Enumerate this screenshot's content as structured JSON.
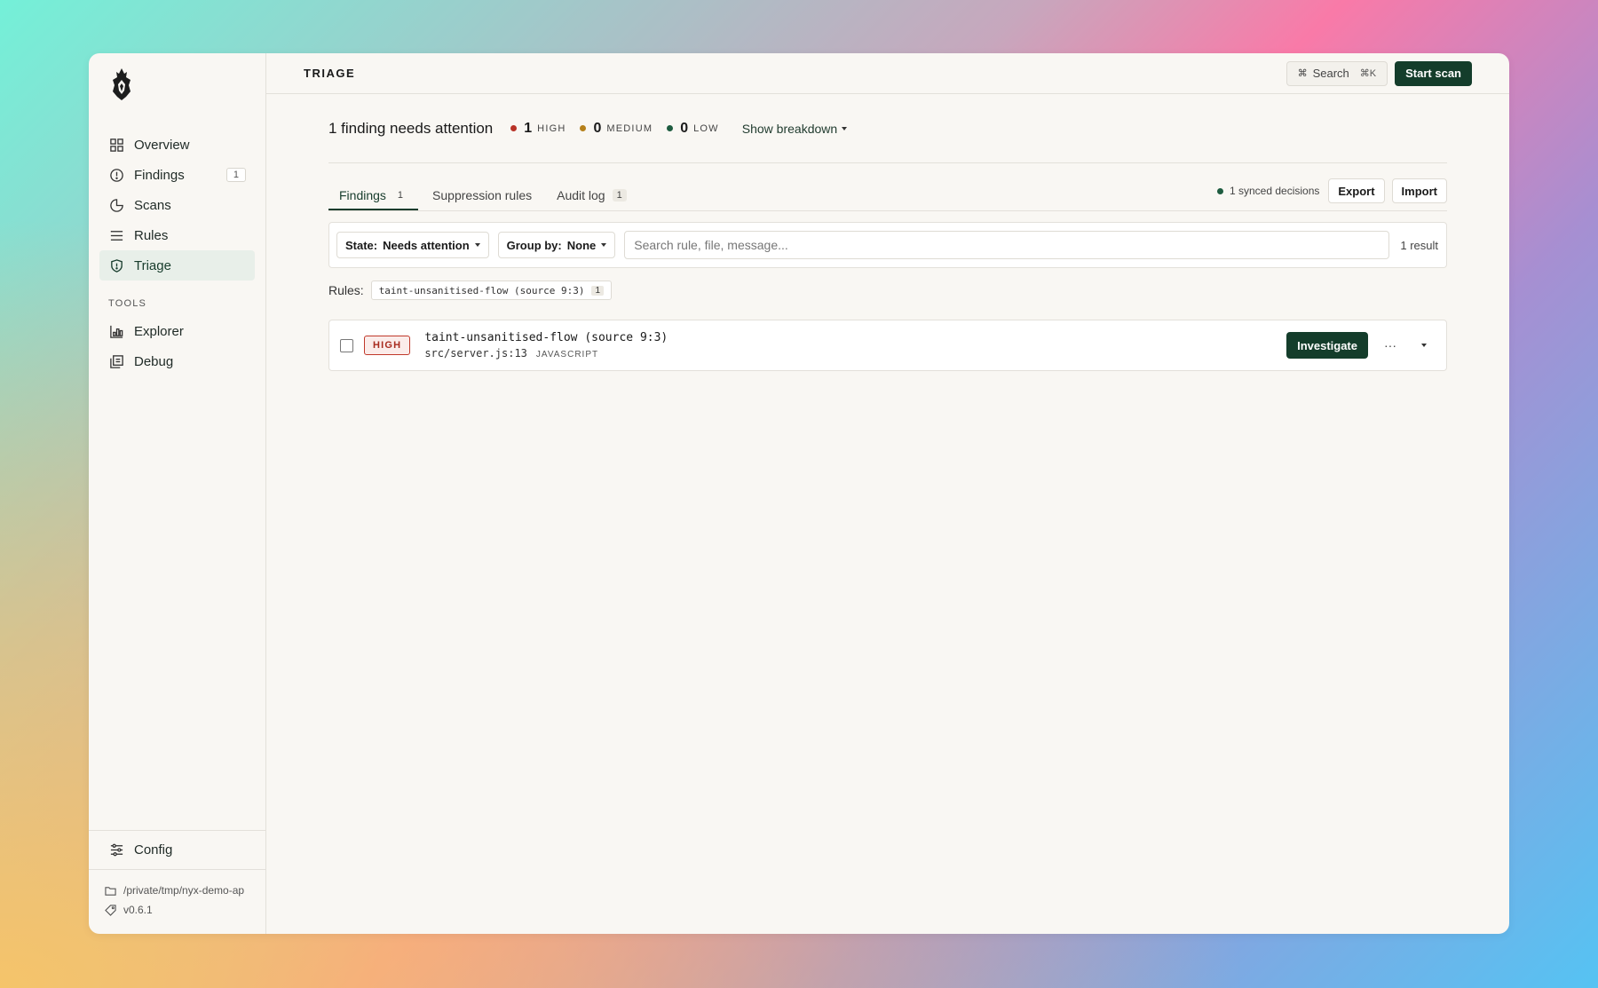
{
  "sidebar": {
    "items": [
      {
        "label": "Overview",
        "icon": "grid-icon"
      },
      {
        "label": "Findings",
        "icon": "shield-icon",
        "badge": "1"
      },
      {
        "label": "Scans",
        "icon": "pie-icon"
      },
      {
        "label": "Rules",
        "icon": "list-icon"
      },
      {
        "label": "Triage",
        "icon": "shield-check-icon",
        "active": true
      }
    ],
    "tools_label": "TOOLS",
    "tools": [
      {
        "label": "Explorer",
        "icon": "chart-icon"
      },
      {
        "label": "Debug",
        "icon": "copy-icon"
      }
    ],
    "config_label": "Config",
    "path": "/private/tmp/nyx-demo-ap",
    "version": "v0.6.1"
  },
  "topbar": {
    "title": "TRIAGE",
    "search_label": "Search",
    "search_shortcut": "⌘K",
    "start_scan_label": "Start scan"
  },
  "summary": {
    "title": "1 finding needs attention",
    "high_count": "1",
    "high_label": "HIGH",
    "medium_count": "0",
    "medium_label": "MEDIUM",
    "low_count": "0",
    "low_label": "LOW",
    "breakdown_label": "Show breakdown"
  },
  "tabs": [
    {
      "label": "Findings",
      "count": "1",
      "active": true
    },
    {
      "label": "Suppression rules"
    },
    {
      "label": "Audit log",
      "count": "1"
    }
  ],
  "sync_label": "1 synced decisions",
  "export_label": "Export",
  "import_label": "Import",
  "filters": {
    "state_label": "State:",
    "state_value": "Needs attention",
    "group_label": "Group by:",
    "group_value": "None",
    "search_placeholder": "Search rule, file, message...",
    "result_count": "1 result"
  },
  "rules_label": "Rules:",
  "rule_chip": {
    "label": "taint-unsanitised-flow (source 9:3)",
    "count": "1"
  },
  "finding": {
    "severity": "HIGH",
    "title": "taint-unsanitised-flow (source 9:3)",
    "path": "src/server.js:13",
    "language": "JAVASCRIPT",
    "investigate_label": "Investigate",
    "more_label": "···"
  },
  "colors": {
    "accent": "#143d2b",
    "high": "#b83227",
    "medium": "#b5801a",
    "low": "#1e5c40"
  }
}
